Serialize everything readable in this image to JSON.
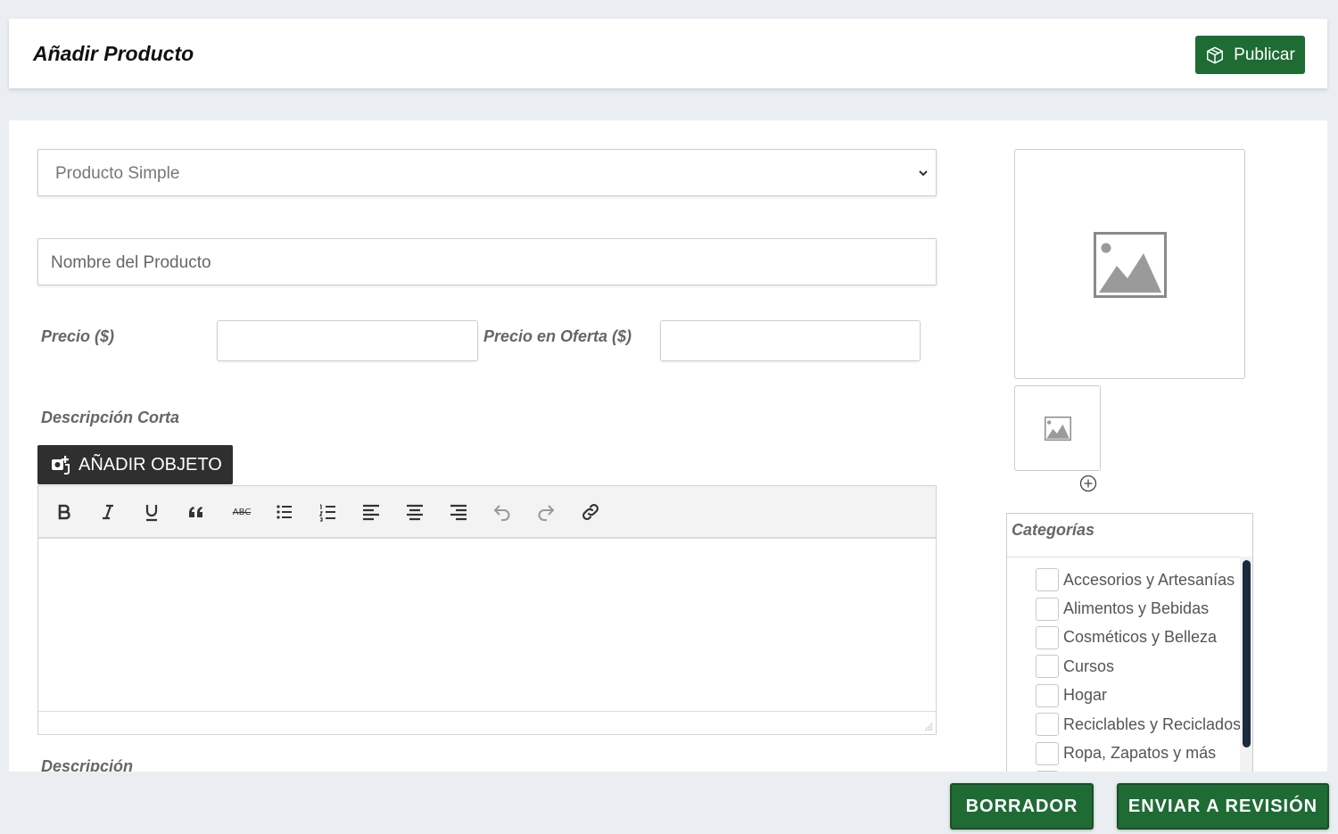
{
  "header": {
    "title": "Añadir Producto",
    "publish_label": "Publicar"
  },
  "form": {
    "product_type": {
      "selected": "Producto Simple"
    },
    "product_name": {
      "placeholder": "Nombre del Producto"
    },
    "price_label": "Precio ($)",
    "sale_price_label": "Precio en Oferta ($)",
    "short_description_label": "Descripción Corta",
    "add_object_label": "AÑADIR OBJETO",
    "description_label": "Descripción",
    "toolbar": {
      "strike_text": "ABC"
    }
  },
  "categories": {
    "title": "Categorías",
    "items": [
      "Accesorios y Artesanías",
      "Alimentos y Bebidas",
      "Cosméticos y Belleza",
      "Cursos",
      "Hogar",
      "Reciclables y Reciclados",
      "Ropa, Zapatos y más"
    ]
  },
  "footer": {
    "draft_label": "BORRADOR",
    "submit_label": "ENVIAR A REVISIÓN"
  },
  "colors": {
    "primary_green": "#1e6b34",
    "dark_button": "#2f2f2f",
    "scroll_thumb": "#1b2a3e"
  }
}
